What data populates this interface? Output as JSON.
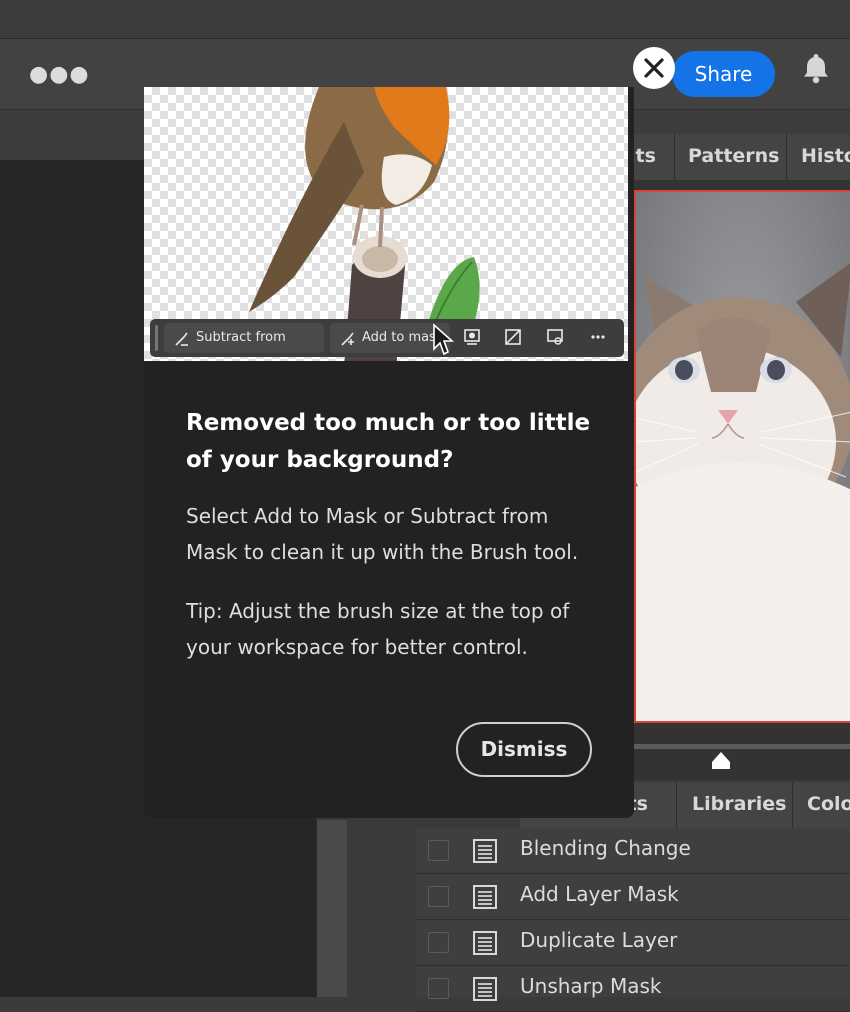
{
  "header": {
    "more_icon": "more-horizontal-icon",
    "share_label": "Share",
    "close_icon": "close-icon",
    "bell_icon": "bell-icon"
  },
  "panel_tabs": {
    "top": [
      "nts",
      "Patterns",
      "Histo"
    ],
    "bottom": [
      "nts",
      "Libraries",
      "Colo"
    ]
  },
  "history": {
    "items": [
      {
        "label": "Blending Change"
      },
      {
        "label": "Add Layer Mask"
      },
      {
        "label": "Duplicate Layer"
      },
      {
        "label": "Unsharp Mask"
      }
    ]
  },
  "coachmark": {
    "toolbar": {
      "subtract_label": "Subtract from mask",
      "add_label": "Add to mask"
    },
    "title": "Removed too much or too little of your background?",
    "body1": "Select Add to Mask or Subtract from Mask to clean it up with the Brush tool.",
    "body2": "Tip: Adjust the brush size at the top of your workspace for better control.",
    "dismiss_label": "Dismiss"
  },
  "colors": {
    "accent": "#1473e6",
    "selection_border": "#d9423c",
    "coachmark_bg": "#222222"
  }
}
